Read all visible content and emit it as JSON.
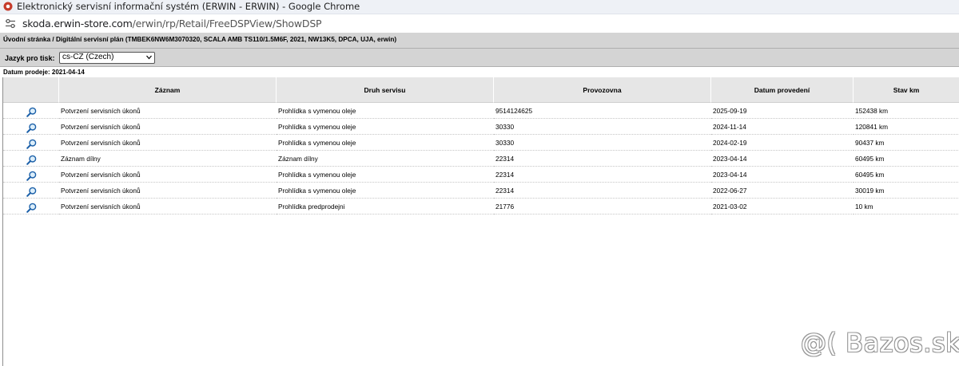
{
  "window": {
    "title": "Elektronický servisní informační systém (ERWIN - ERWIN) - Google Chrome"
  },
  "address": {
    "domain": "skoda.erwin-store.com",
    "path": "/erwin/rp/Retail/FreeDSPView/ShowDSP"
  },
  "breadcrumb": "Úvodní stránka / Digitální servisní plán (TMBEK6NW6M3070320, SCALA AMB TS110/1.5M6F, 2021, NW13K5, DPCA, UJA, erwin)",
  "print_language": {
    "label": "Jazyk pro tisk:",
    "selected": "cs-CZ (Czech)"
  },
  "sale_date": "Datum prodeje: 2021-04-14",
  "table": {
    "headers": [
      "",
      "Záznam",
      "Druh servisu",
      "Provozovna",
      "Datum provedení",
      "Stav km"
    ],
    "rows": [
      [
        "Potvrzení servisních úkonů",
        "Prohlídka s vymenou oleje",
        "9514124625",
        "2025-09-19",
        "152438 km"
      ],
      [
        "Potvrzení servisních úkonů",
        "Prohlídka s vymenou oleje",
        "30330",
        "2024-11-14",
        "120841 km"
      ],
      [
        "Potvrzení servisních úkonů",
        "Prohlídka s vymenou oleje",
        "30330",
        "2024-02-19",
        "90437 km"
      ],
      [
        "Záznam dílny",
        "Záznam dílny",
        "22314",
        "2023-04-14",
        "60495 km"
      ],
      [
        "Potvrzení servisních úkonů",
        "Prohlídka s vymenou oleje",
        "22314",
        "2023-04-14",
        "60495 km"
      ],
      [
        "Potvrzení servisních úkonů",
        "Prohlídka s vymenou oleje",
        "22314",
        "2022-06-27",
        "30019 km"
      ],
      [
        "Potvrzení servisních úkonů",
        "Prohlídka predprodejni",
        "21776",
        "2021-03-02",
        "10 km"
      ]
    ]
  },
  "watermark": "@( Bazos.sk",
  "icons": {
    "row_action": "magnifier-icon",
    "site_info": "tune-icon",
    "app": "chrome-app-icon"
  }
}
